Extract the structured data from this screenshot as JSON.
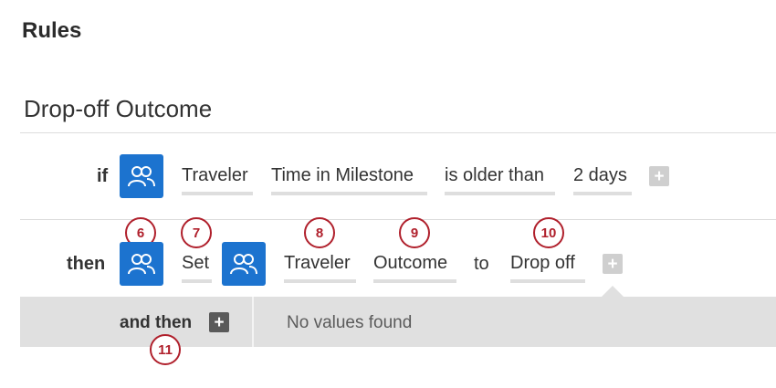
{
  "page": {
    "title": "Rules"
  },
  "rule": {
    "title": "Drop-off Outcome",
    "if_row": {
      "keyword": "if",
      "icon": "people-icon",
      "tokens": [
        "Traveler",
        "Time in Milestone",
        "is older than",
        "2 days"
      ]
    },
    "then_row": {
      "keyword": "then",
      "icon": "people-icon",
      "set_label": "Set",
      "target_icon": "people-icon",
      "tokens": [
        "Traveler",
        "Outcome"
      ],
      "to_label": "to",
      "value": "Drop off"
    },
    "and_then": {
      "label": "and then",
      "empty_text": "No values found"
    }
  },
  "markers": [
    "6",
    "7",
    "8",
    "9",
    "10",
    "11"
  ],
  "colors": {
    "accent": "#1c73cf",
    "marker": "#b0202c",
    "panel": "#e0e0e0"
  }
}
